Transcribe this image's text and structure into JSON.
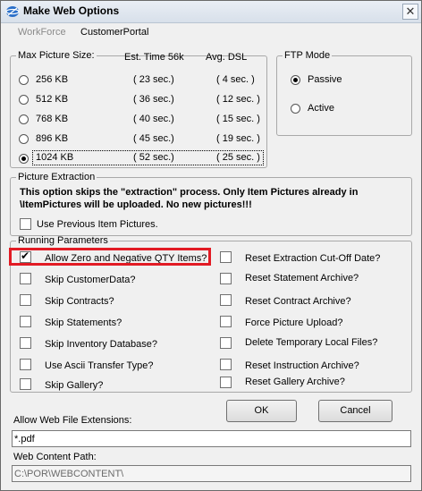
{
  "window": {
    "title": "Make Web Options",
    "close_glyph": "✕"
  },
  "tabs": [
    {
      "label": "WorkForce"
    },
    {
      "label": "CustomerPortal"
    }
  ],
  "picture_size": {
    "headers": {
      "size": "Max Picture Size:",
      "time": "Est. Time  56k",
      "dsl": "Avg. DSL"
    },
    "rows": [
      {
        "size": "256 KB",
        "time": "( 23 sec.)",
        "dsl": "( 4 sec. )",
        "selected": false
      },
      {
        "size": "512 KB",
        "time": "( 36 sec.)",
        "dsl": "( 12 sec. )",
        "selected": false
      },
      {
        "size": "768 KB",
        "time": "( 40 sec.)",
        "dsl": "( 15 sec. )",
        "selected": false
      },
      {
        "size": "896 KB",
        "time": "( 45 sec.)",
        "dsl": "( 19 sec. )",
        "selected": false
      },
      {
        "size": "1024 KB",
        "time": "( 52 sec.)",
        "dsl": "( 25 sec. )",
        "selected": true
      }
    ]
  },
  "ftp_mode": {
    "legend": "FTP Mode",
    "options": [
      {
        "label": "Passive",
        "selected": true
      },
      {
        "label": "Active",
        "selected": false
      }
    ]
  },
  "picture_extraction": {
    "legend": "Picture Extraction",
    "note_line1": "This option skips the \"extraction\" process. Only Item Pictures already in",
    "note_line2": "\\ItemPictures will be uploaded. No new pictures!!!",
    "checkbox": {
      "label": "Use Previous Item Pictures.",
      "checked": false
    }
  },
  "running_parameters": {
    "legend": "Running Parameters",
    "left": [
      {
        "label": "Allow Zero and Negative QTY Items?",
        "checked": true
      },
      {
        "label": "Skip CustomerData?",
        "checked": false
      },
      {
        "label": "Skip Contracts?",
        "checked": false
      },
      {
        "label": "Skip Statements?",
        "checked": false
      },
      {
        "label": "Skip Inventory Database?",
        "checked": false
      },
      {
        "label": "Use Ascii Transfer Type?",
        "checked": false
      },
      {
        "label": "Skip Gallery?",
        "checked": false
      }
    ],
    "right": [
      {
        "label": "Reset Extraction Cut-Off Date?",
        "checked": false
      },
      {
        "label": "Reset Statement Archive?",
        "checked": false
      },
      {
        "label": "Reset Contract Archive?",
        "checked": false
      },
      {
        "label": "Force Picture Upload?",
        "checked": false
      },
      {
        "label": "Delete Temporary Local Files?",
        "checked": false
      },
      {
        "label": "Reset Instruction Archive?",
        "checked": false
      },
      {
        "label": "Reset Gallery Archive?",
        "checked": false
      }
    ]
  },
  "buttons": {
    "ok": "OK",
    "cancel": "Cancel"
  },
  "extensions": {
    "label": "Allow Web File Extensions:",
    "value": "*.pdf"
  },
  "content_path": {
    "label": "Web Content Path:",
    "value": "C:\\POR\\WEBCONTENT\\"
  },
  "colors": {
    "highlight": "#e21b24"
  }
}
